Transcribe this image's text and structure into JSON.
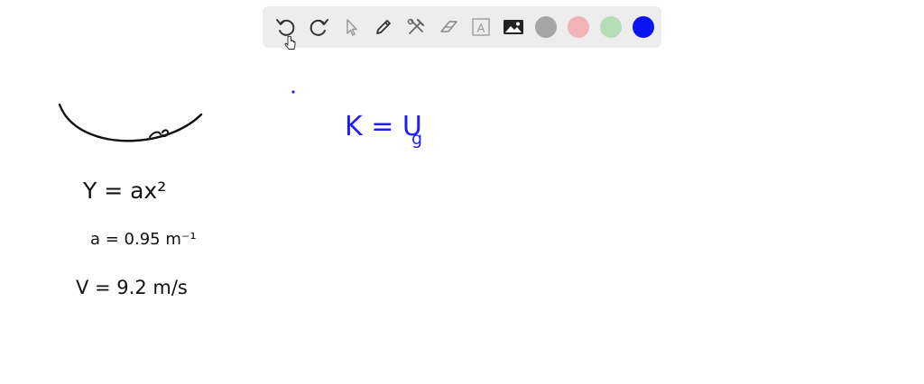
{
  "toolbar": {
    "tools": [
      {
        "name": "undo",
        "icon": "undo-icon"
      },
      {
        "name": "redo",
        "icon": "redo-icon"
      },
      {
        "name": "select",
        "icon": "pointer-icon"
      },
      {
        "name": "pen",
        "icon": "pen-icon"
      },
      {
        "name": "tools",
        "icon": "hammer-wrench-icon"
      },
      {
        "name": "eraser",
        "icon": "eraser-icon"
      },
      {
        "name": "text",
        "icon": "text-box-icon",
        "glyph": "A"
      },
      {
        "name": "image",
        "icon": "image-icon"
      }
    ],
    "colors": {
      "gray": "#a5a5a5",
      "pink": "#f2b3b6",
      "green": "#b6dcb6",
      "blue": "#0a14f0"
    }
  },
  "whiteboard": {
    "eq_y": "Y = ax²",
    "eq_a": "a = 0.95 m⁻¹",
    "eq_v": "V = 9.2 m/s",
    "eq_k": "K = U",
    "eq_k_sub": "g",
    "ink_color": "#111111",
    "accent_color": "#1f1ff0"
  }
}
